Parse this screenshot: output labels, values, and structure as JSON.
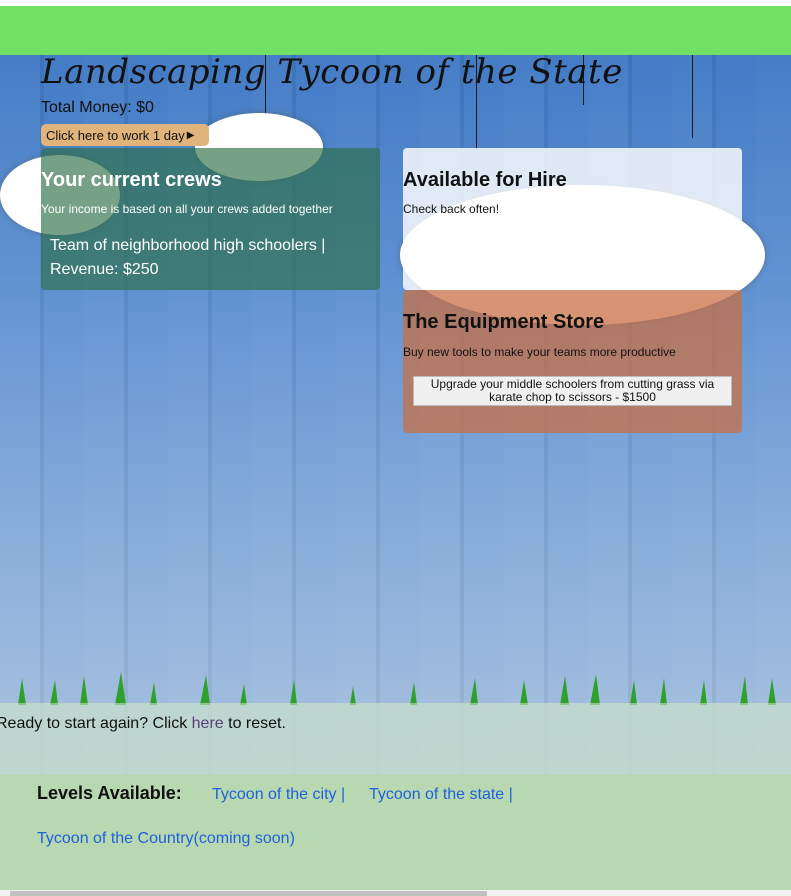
{
  "header": {
    "title": "Landscaping Tycoon of the State",
    "total_money_label": "Total Money: $0",
    "work_button_label": "Click here to work 1 day"
  },
  "crews": {
    "heading": "Your current crews",
    "subtitle": "Your income is based on all your crews added together",
    "items": [
      {
        "line1": "Team of neighborhood high schoolers |",
        "line2": "Revenue: $250"
      }
    ]
  },
  "hire": {
    "heading": "Available for Hire",
    "subtitle": "Check back often!"
  },
  "store": {
    "heading": "The Equipment Store",
    "subtitle": "Buy new tools to make your teams more productive",
    "upgrade_button_label": "Upgrade your middle schoolers from cutting grass via karate chop to scissors - $1500"
  },
  "reset": {
    "prefix": "Ready to start again? Click ",
    "link": "here",
    "suffix": " to reset."
  },
  "levels": {
    "label": "Levels Available:",
    "links": [
      "Tycoon of the city |",
      "Tycoon of the state |",
      "Tycoon of the Country(coming soon)"
    ]
  },
  "colors": {
    "top_bar": "#72e064",
    "crews_panel": "#2c6e46",
    "store_panel": "#c87046",
    "link": "#2060d8",
    "levels_bar": "#b8d8b2"
  }
}
